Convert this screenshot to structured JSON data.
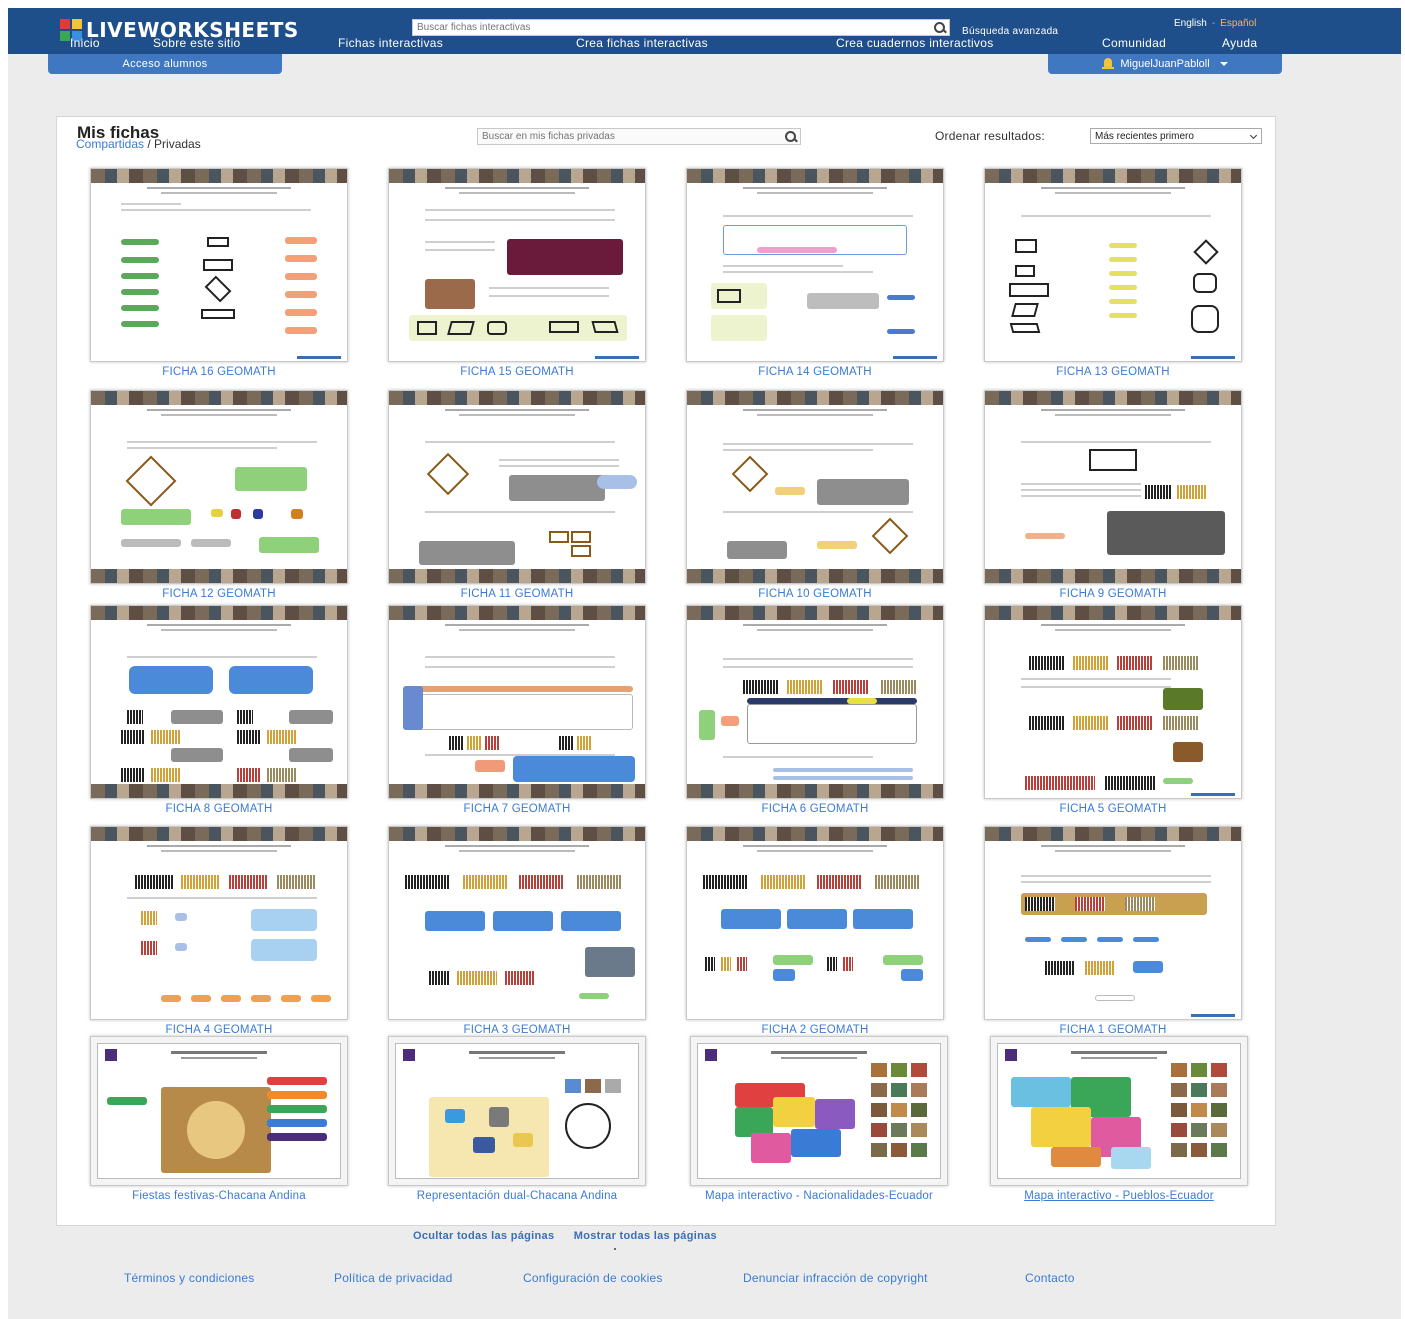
{
  "brand": {
    "name": "LIVEWORKSHEETS"
  },
  "topbar": {
    "search_placeholder": "Buscar fichas interactivas",
    "advanced_search": "Búsqueda avanzada",
    "lang_en": "English",
    "lang_sep": "-",
    "lang_es": "Español"
  },
  "nav": {
    "items": [
      "Inicio",
      "Sobre este sitio",
      "Fichas interactivas",
      "Crea fichas interactivas",
      "Crea cuadernos interactivos",
      "Comunidad",
      "Ayuda"
    ]
  },
  "access_students": "Acceso alumnos",
  "user": {
    "name": "MiguelJuanPabloll"
  },
  "panel": {
    "title": "Mis fichas",
    "shared": "Compartidas",
    "slash": " / ",
    "private": "Privadas",
    "search_placeholder": "Buscar en mis fichas privadas",
    "sort_label": "Ordenar resultados:",
    "sort_value": "Más recientes primero"
  },
  "worksheets": [
    "FICHA 16 GEOMATH",
    "FICHA 15 GEOMATH",
    "FICHA 14 GEOMATH",
    "FICHA 13 GEOMATH",
    "FICHA 12 GEOMATH",
    "FICHA 11 GEOMATH",
    "FICHA 10 GEOMATH",
    "FICHA 9 GEOMATH",
    "FICHA 8 GEOMATH",
    "FICHA 7 GEOMATH",
    "FICHA 6 GEOMATH",
    "FICHA 5 GEOMATH",
    "FICHA 4 GEOMATH",
    "FICHA 3 GEOMATH",
    "FICHA 2 GEOMATH",
    "FICHA 1 GEOMATH",
    "Fiestas festivas-Chacana Andina",
    "Representación dual-Chacana Andina",
    "Mapa interactivo - Nacionalidades-Ecuador",
    "Mapa interactivo - Pueblos-Ecuador"
  ],
  "pages_links": {
    "hide": "Ocultar todas las páginas",
    "show": "Mostrar todas las páginas"
  },
  "footer": {
    "terms": "Términos y condiciones",
    "privacy": "Política de privacidad",
    "cookies": "Configuración de cookies",
    "copyright": "Denunciar infracción de copyright",
    "contact": "Contacto"
  },
  "colors": {
    "header": "#1f4f8a",
    "tab": "#3f78c0",
    "link": "#3a7bd5"
  }
}
